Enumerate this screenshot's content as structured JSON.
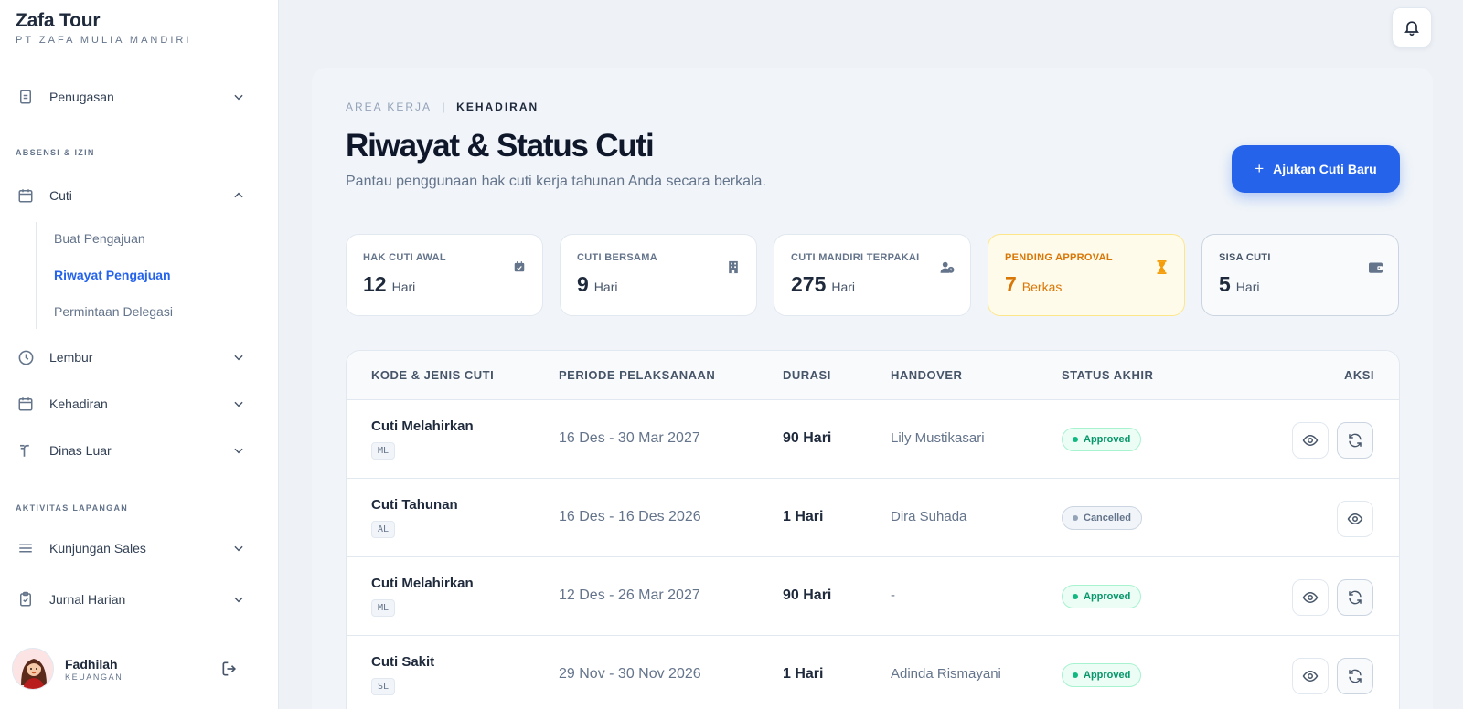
{
  "brand": {
    "name": "Zafa Tour",
    "company": "PT ZAFA MULIA MANDIRI"
  },
  "sidebar": {
    "penugasan": "Penugasan",
    "section_absensi": "ABSENSI & IZIN",
    "cuti": "Cuti",
    "cuti_sub": [
      "Buat Pengajuan",
      "Riwayat Pengajuan",
      "Permintaan Delegasi"
    ],
    "lembur": "Lembur",
    "kehadiran": "Kehadiran",
    "dinas_luar": "Dinas Luar",
    "section_aktivitas": "AKTIVITAS LAPANGAN",
    "kunjungan_sales": "Kunjungan Sales",
    "jurnal_harian": "Jurnal Harian"
  },
  "user": {
    "name": "Fadhilah",
    "role": "KEUANGAN"
  },
  "breadcrumb": {
    "area": "AREA KERJA",
    "current": "KEHADIRAN"
  },
  "page": {
    "title": "Riwayat & Status Cuti",
    "subtitle": "Pantau penggunaan hak cuti kerja tahunan Anda secara berkala.",
    "new_button": "Ajukan Cuti Baru"
  },
  "stats": [
    {
      "label": "HAK CUTI AWAL",
      "value": "12",
      "unit": "Hari"
    },
    {
      "label": "CUTI BERSAMA",
      "value": "9",
      "unit": "Hari"
    },
    {
      "label": "CUTI MANDIRI TERPAKAI",
      "value": "275",
      "unit": "Hari"
    },
    {
      "label": "PENDING APPROVAL",
      "value": "7",
      "unit": "Berkas"
    },
    {
      "label": "SISA CUTI",
      "value": "5",
      "unit": "Hari"
    }
  ],
  "table": {
    "headers": [
      "KODE & JENIS CUTI",
      "PERIODE PELAKSANAAN",
      "DURASI",
      "HANDOVER",
      "STATUS AKHIR",
      "AKSI"
    ],
    "rows": [
      {
        "name": "Cuti Melahirkan",
        "code": "ML",
        "period": "16 Des - 30 Mar 2027",
        "duration": "90 Hari",
        "handover": "Lily Mustikasari",
        "status": "Approved"
      },
      {
        "name": "Cuti Tahunan",
        "code": "AL",
        "period": "16 Des - 16 Des 2026",
        "duration": "1 Hari",
        "handover": "Dira Suhada",
        "status": "Cancelled"
      },
      {
        "name": "Cuti Melahirkan",
        "code": "ML",
        "period": "12 Des - 26 Mar 2027",
        "duration": "90 Hari",
        "handover": "-",
        "status": "Approved"
      },
      {
        "name": "Cuti Sakit",
        "code": "SL",
        "period": "29 Nov - 30 Nov 2026",
        "duration": "1 Hari",
        "handover": "Adinda Rismayani",
        "status": "Approved"
      }
    ]
  },
  "colors": {
    "accent": "#2563eb",
    "pending": "#d97706",
    "approved": "#059669"
  }
}
